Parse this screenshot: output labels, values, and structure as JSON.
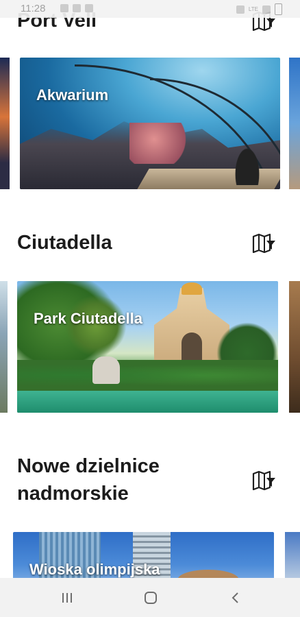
{
  "status_bar": {
    "time": "11:28",
    "network": "LTE"
  },
  "sections": [
    {
      "title": "Port Vell",
      "card_label": "Akwarium",
      "map_icon": "map-filter-icon"
    },
    {
      "title": "Ciutadella",
      "card_label": "Park Ciutadella",
      "map_icon": "map-filter-icon"
    },
    {
      "title": "Nowe dzielnice nadmorskie",
      "card_label": "Wioska olimpijska",
      "map_icon": "map-filter-icon"
    }
  ],
  "nav_bar": {
    "icons": [
      "recent-apps-icon",
      "home-icon",
      "back-icon"
    ]
  },
  "colors": {
    "title_text": "#1c1c1c",
    "label_text": "#ffffff",
    "bar_background": "#f2f2f2"
  }
}
